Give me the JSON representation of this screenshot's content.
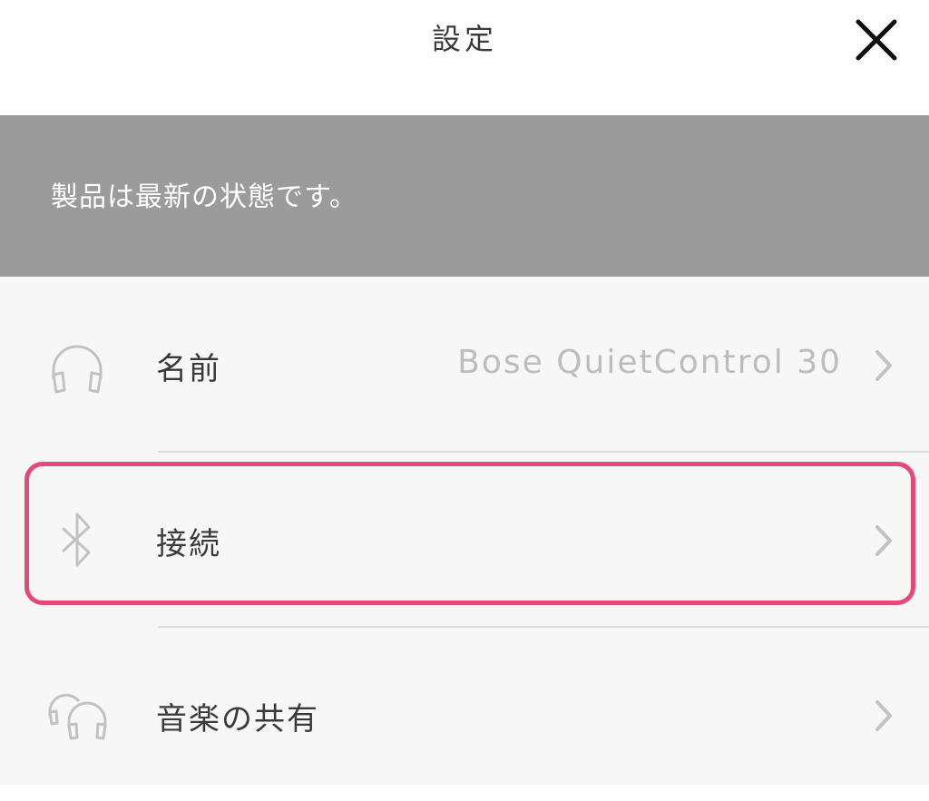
{
  "header": {
    "title": "設定",
    "close_icon": "close-icon"
  },
  "banner": {
    "text": "製品は最新の状態です。"
  },
  "settings": {
    "items": [
      {
        "label": "名前",
        "value": "Bose QuietControl 30",
        "icon": "headphones-icon"
      },
      {
        "label": "接続",
        "value": "",
        "icon": "bluetooth-icon"
      },
      {
        "label": "音楽の共有",
        "value": "",
        "icon": "shared-headphones-icon"
      }
    ]
  },
  "colors": {
    "header_bg": "#ffffff",
    "banner_bg": "#9b9b9b",
    "list_bg": "#f7f7f7",
    "highlight": "#e5497a",
    "label_text": "#3a3a3a",
    "muted_text": "#bdbdbd"
  }
}
